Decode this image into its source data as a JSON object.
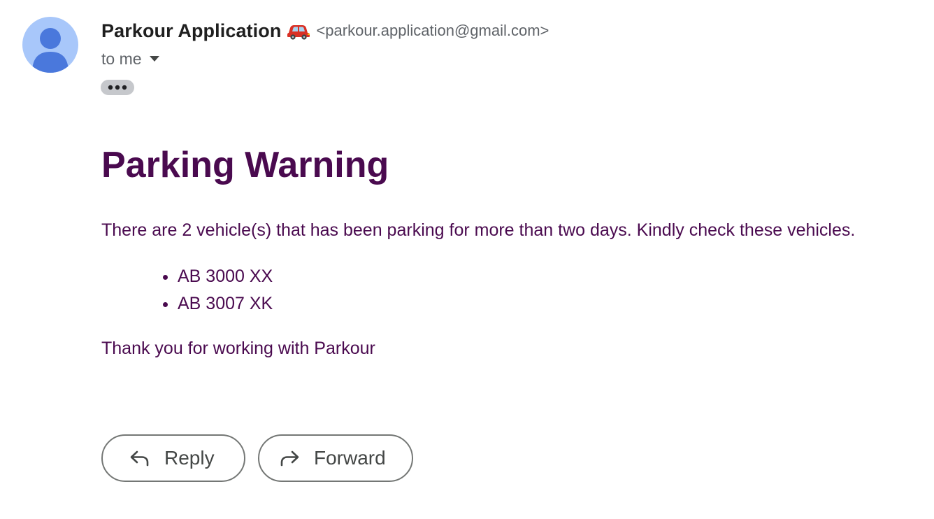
{
  "sender": {
    "name": "Parkour Application",
    "emoji": "🚗",
    "email": "<parkour.application@gmail.com>"
  },
  "recipient": {
    "label": "to me"
  },
  "message": {
    "heading": "Parking Warning",
    "intro": "There are 2 vehicle(s) that has been parking for more than two days. Kindly check these vehicles.",
    "vehicles": [
      "AB 3000 XX",
      "AB 3007 XK"
    ],
    "closing": "Thank you for working with Parkour"
  },
  "actions": {
    "reply_label": "Reply",
    "forward_label": "Forward"
  },
  "colors": {
    "accent_text": "#4a0a4f",
    "avatar_bg": "#a8c7fa",
    "avatar_fg": "#4a78dc",
    "secondary_text": "#5f6368"
  },
  "icons": {
    "avatar": "person-icon",
    "more": "more-horiz-icon",
    "caret": "caret-down-icon",
    "reply": "reply-arrow-icon",
    "forward": "forward-arrow-icon",
    "sender_emoji": "car-emoji-icon"
  }
}
